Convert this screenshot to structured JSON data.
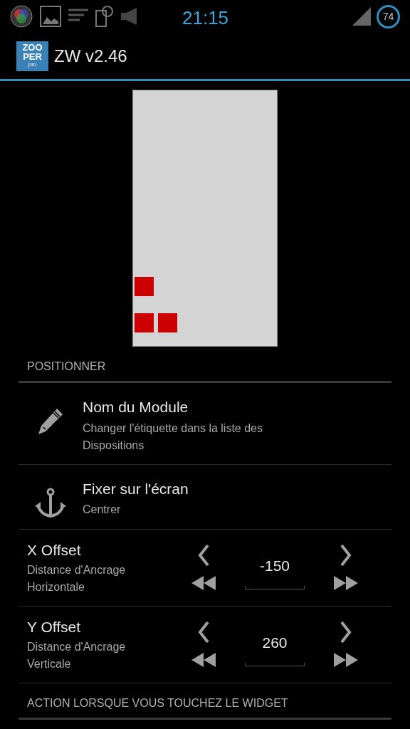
{
  "status_bar": {
    "time": "21:15",
    "battery": "74"
  },
  "app_bar": {
    "logo": [
      "ZOO",
      "PER",
      "pro"
    ],
    "title": "ZW v2.46"
  },
  "sections": [
    {
      "header": "POSITIONNER",
      "items": [
        {
          "kind": "edit",
          "title": "Nom du Module",
          "subtitle": "Changer l'étiquette dans la liste des Dispositions"
        },
        {
          "kind": "anchor",
          "title": "Fixer sur l'écran",
          "subtitle": "Centrer"
        },
        {
          "kind": "stepper",
          "title": "X Offset",
          "subtitle": "Distance d'Ancrage Horizontale",
          "value": "-150"
        },
        {
          "kind": "stepper",
          "title": "Y Offset",
          "subtitle": "Distance d'Ancrage Verticale",
          "value": "260"
        }
      ]
    },
    {
      "header": "ACTION LORSQUE VOUS TOUCHEZ LE WIDGET"
    }
  ]
}
